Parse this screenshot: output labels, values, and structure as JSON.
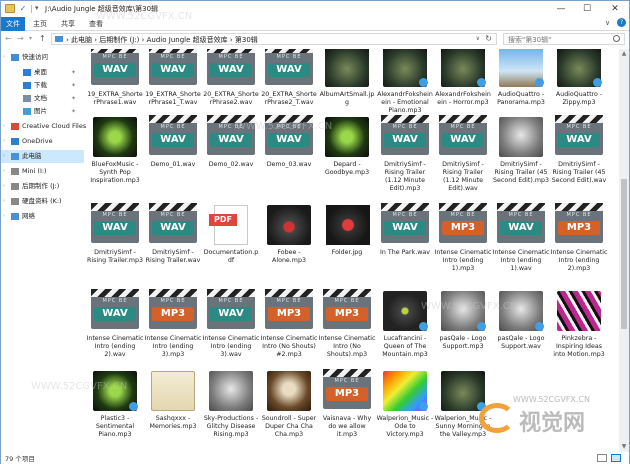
{
  "window": {
    "title": "J:\\Audio Jungle 超级音效库\\第30辑",
    "controls": {
      "minimize": "—",
      "maximize": "☐",
      "close": "✕"
    }
  },
  "ribbon": {
    "tabs": [
      "文件",
      "主页",
      "共享",
      "查看"
    ]
  },
  "nav": {
    "back": "←",
    "forward": "→",
    "recent": "▾",
    "up": "↑",
    "path": "›  此电脑  ›  后期制作 (J:)  ›  Audio Jungle 超级音效库  ›  第30辑",
    "search_placeholder": "搜索\"第30辑\""
  },
  "sidebar": {
    "items": [
      {
        "label": "快速访问",
        "kind": "star",
        "expand": true
      },
      {
        "label": "桌面",
        "kind": "desktop",
        "pin": true
      },
      {
        "label": "下载",
        "kind": "download",
        "pin": true
      },
      {
        "label": "文档",
        "kind": "doc",
        "pin": true
      },
      {
        "label": "图片",
        "kind": "pic",
        "pin": true
      },
      {
        "label": "Creative Cloud Files",
        "kind": "cc",
        "expand": true
      },
      {
        "label": "OneDrive",
        "kind": "cloud",
        "expand": true
      },
      {
        "label": "此电脑",
        "kind": "pc",
        "expand": true,
        "selected": true
      },
      {
        "label": "Mini (I:)",
        "kind": "drive",
        "expand": true
      },
      {
        "label": "后期制作 (J:)",
        "kind": "drive",
        "expand": true
      },
      {
        "label": "硬盘资料 (K:)",
        "kind": "drive",
        "expand": true
      },
      {
        "label": "网络",
        "kind": "net",
        "expand": true
      }
    ]
  },
  "files": [
    {
      "name": "19_EXTRA_ShorterPhrase1.wav",
      "type": "wav"
    },
    {
      "name": "19_EXTRA_ShorterPhrase1_T.wav",
      "type": "wav"
    },
    {
      "name": "20_EXTRA_ShorterPhrase2.wav",
      "type": "wav"
    },
    {
      "name": "20_EXTRA_ShorterPhrase2_T.wav",
      "type": "wav"
    },
    {
      "name": "AlbumArtSmall.jpg",
      "type": "art",
      "art": "art-dark"
    },
    {
      "name": "AlexandrFoksheinein - Emotional Piano.mp3",
      "type": "art",
      "art": "art-dark",
      "play": true
    },
    {
      "name": "AlexandrFoksheinein - Horror.mp3",
      "type": "art",
      "art": "art-dark",
      "play": true
    },
    {
      "name": "AudioQuattro - Panorama.mp3",
      "type": "art",
      "art": "art-sky",
      "play": true
    },
    {
      "name": "AudioQuattro - Zippy.mp3",
      "type": "art",
      "art": "art-dark",
      "play": true
    },
    {
      "name": "BlueFoxMusic - Synth Pop Inspiration.mp3",
      "type": "art",
      "art": "art-green"
    },
    {
      "name": "Demo_01.wav",
      "type": "wav"
    },
    {
      "name": "Demo_02.wav",
      "type": "wav"
    },
    {
      "name": "Demo_03.wav",
      "type": "wav"
    },
    {
      "name": "Depard - Goodbye.mp3",
      "type": "art",
      "art": "art-green"
    },
    {
      "name": "DmitriySimf - Rising Trailer (1.12 Minute Edit).mp3",
      "type": "wav"
    },
    {
      "name": "DmitriySimf - Rising Trailer (1.12 Minute Edit).wav",
      "type": "wav"
    },
    {
      "name": "DmitriySimf - Rising Trailer (45 Second Edit).mp3",
      "type": "art",
      "art": "art-grey"
    },
    {
      "name": "DmitriySimf - Rising Trailer (45 Second Edit).wav",
      "type": "wav"
    },
    {
      "name": "DmitriySimf - Rising Trailer.mp3",
      "type": "wav"
    },
    {
      "name": "DmitriySimf - Rising Trailer.wav",
      "type": "wav"
    },
    {
      "name": "Documentation.pdf",
      "type": "pdf"
    },
    {
      "name": "Fobee - Alone.mp3",
      "type": "art",
      "art": "art-phone"
    },
    {
      "name": "Folder.jpg",
      "type": "folder"
    },
    {
      "name": "In The Park.wav",
      "type": "wav"
    },
    {
      "name": "Intense Cinematic Intro (ending 1).mp3",
      "type": "mp3"
    },
    {
      "name": "Intense Cinematic Intro (ending 1).wav",
      "type": "wav"
    },
    {
      "name": "Intense Cinematic Intro (ending 2).mp3",
      "type": "mp3"
    },
    {
      "name": "Intense Cinematic Intro (ending 2).wav",
      "type": "wav"
    },
    {
      "name": "Intense Cinematic Intro (ending 3).mp3",
      "type": "mp3"
    },
    {
      "name": "Intense Cinematic Intro (ending 3).wav",
      "type": "wav"
    },
    {
      "name": "Intense Cinematic Intro (No Shouts) #2.mp3",
      "type": "mp3"
    },
    {
      "name": "Intense Cinematic Intro (No Shouts).mp3",
      "type": "mp3"
    },
    {
      "name": "Lucafrancini - Queen of The Mountain.mp3",
      "type": "art",
      "art": "art-orb",
      "play": true
    },
    {
      "name": "pasQale - Logo Support.mp3",
      "type": "art",
      "art": "art-grey",
      "play": true
    },
    {
      "name": "pasQale - Logo Support.wav",
      "type": "art",
      "art": "art-grey",
      "play": true
    },
    {
      "name": "Pinkzebra - Inspiring Ideas into Motion.mp3",
      "type": "art",
      "art": "art-zebra"
    },
    {
      "name": "Plastic3 - Sentimental Piano.mp3",
      "type": "art",
      "art": "art-green",
      "play": true
    },
    {
      "name": "Sashqxxx - Memories.mp3",
      "type": "art",
      "art": "art-book"
    },
    {
      "name": "Sky-Productions - Glitchy Disease Rising.mp3",
      "type": "art",
      "art": "art-grey"
    },
    {
      "name": "Soundroll - Super Duper Cha Cha Cha.mp3",
      "type": "art",
      "art": "art-disco"
    },
    {
      "name": "Vaisnava - Why do we allow it.mp3",
      "type": "mp3"
    },
    {
      "name": "Walperion_Music - Ode to Victory.mp3",
      "type": "art",
      "art": "art-rainbow",
      "play": true
    },
    {
      "name": "Walperion_Music - Sunny Morning in the Valley.mp3",
      "type": "art",
      "art": "art-dark",
      "play": true
    }
  ],
  "status": {
    "count": "79 个项目"
  },
  "watermark": {
    "text": "WWW.52CGVFX.CN",
    "url": "WWW.52CGVFX.CN",
    "brand": "视觉网"
  }
}
